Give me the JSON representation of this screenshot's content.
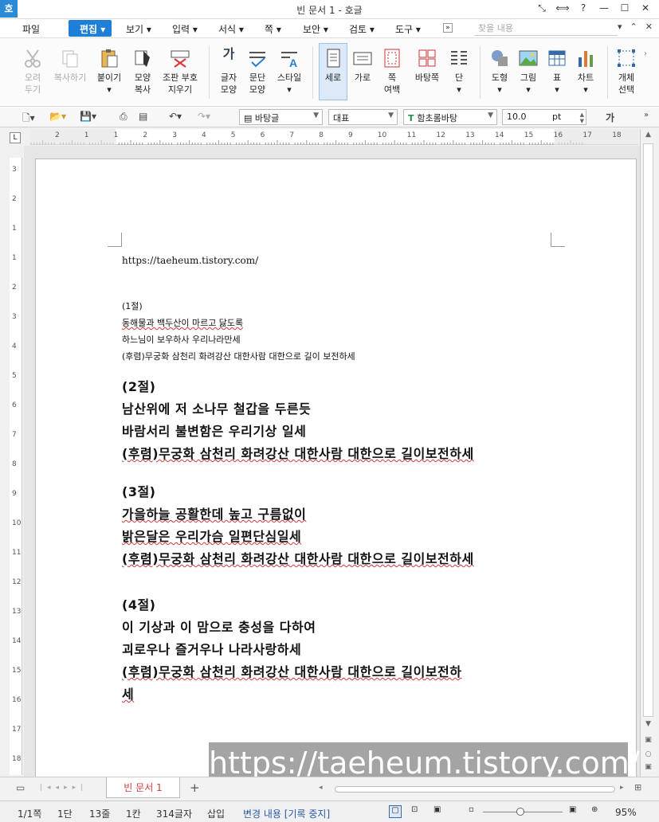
{
  "title": "빈 문서 1 - 호글",
  "app_icon": "호",
  "window_buttons": [
    "⤡",
    "⟺",
    "?",
    "—",
    "☐",
    "✕"
  ],
  "menu": {
    "file": "파일",
    "edit": "편집",
    "view": "보기",
    "input": "입력",
    "format": "서식",
    "page": "쪽",
    "security": "보안",
    "review": "검토",
    "tools": "도구",
    "search_placeholder": "찾을 내용"
  },
  "ribbon": {
    "cut": "오려\n두기",
    "copy": "복사하기",
    "paste": "붙이기",
    "format_copy": "모양\n복사",
    "clear_marks": "조판 부호\n지우기",
    "char_shape": "글자\n모양",
    "para_shape": "문단\n모양",
    "style": "스타일",
    "portrait": "세로",
    "landscape": "가로",
    "page_margin": "쪽\n여백",
    "page_bg": "바탕쪽",
    "columns": "단",
    "shape": "도형",
    "picture": "그림",
    "table": "표",
    "chart": "차트",
    "select_object": "개체\n선택"
  },
  "toolbar": {
    "style_combo": "바탕글",
    "lang_combo": "대표",
    "font_combo": "함초롬바탕",
    "size_value": "10.0",
    "size_unit": "pt",
    "char_btn": "가"
  },
  "ruler_numbers": [
    "2",
    "1",
    "1",
    "2",
    "3",
    "4",
    "5",
    "6",
    "7",
    "8",
    "9",
    "10",
    "11",
    "12",
    "13",
    "14",
    "15",
    "16",
    "17",
    "18"
  ],
  "vruler_numbers": [
    "3",
    "2",
    "1",
    "1",
    "2",
    "3",
    "4",
    "5",
    "6",
    "7",
    "8",
    "9",
    "10",
    "11",
    "12",
    "13",
    "14",
    "15",
    "16",
    "17",
    "18"
  ],
  "doc": {
    "url": "https://taeheum.tistory.com/",
    "verse1": [
      "(1절)",
      "동해물과 백두산이 마르고 닳도록",
      "하느님이 보우하사 우리나라만세",
      "(후렴)무궁화 삼천리 화려강산 대한사람 대한으로 길이 보전하세"
    ],
    "verse2": [
      "(2절)",
      "남산위에 저 소나무 철갑을 두른듯",
      "바람서리 불변함은 우리기상 일세",
      "(후렴)무궁화 삼천리 화려강산 대한사람 대한으로 길이보전하세"
    ],
    "verse3": [
      "(3절)",
      "가을하늘 공활한데 높고 구름없이",
      "밝은달은 우리가슴 일편단심일세",
      "(후렴)무궁화 삼천리 화려강산 대한사람 대한으로 길이보전하세"
    ],
    "verse4": [
      "(4절)",
      "이 기상과 이 맘으로 충성을 다하여",
      "괴로우나 즐거우나 나라사랑하세",
      "(후렴)무궁화 삼천리 화려강산 대한사람 대한으로 길이보전하",
      "세"
    ]
  },
  "watermark": "https://taeheum.tistory.com/",
  "tab": {
    "label": "빈 문서 1",
    "add": "+"
  },
  "status": {
    "page": "1/1쪽",
    "column": "1단",
    "line": "13줄",
    "col": "1칸",
    "chars": "314글자",
    "mode": "삽입",
    "track": "변경 내용 [기록 중지]",
    "zoom": "95%"
  }
}
